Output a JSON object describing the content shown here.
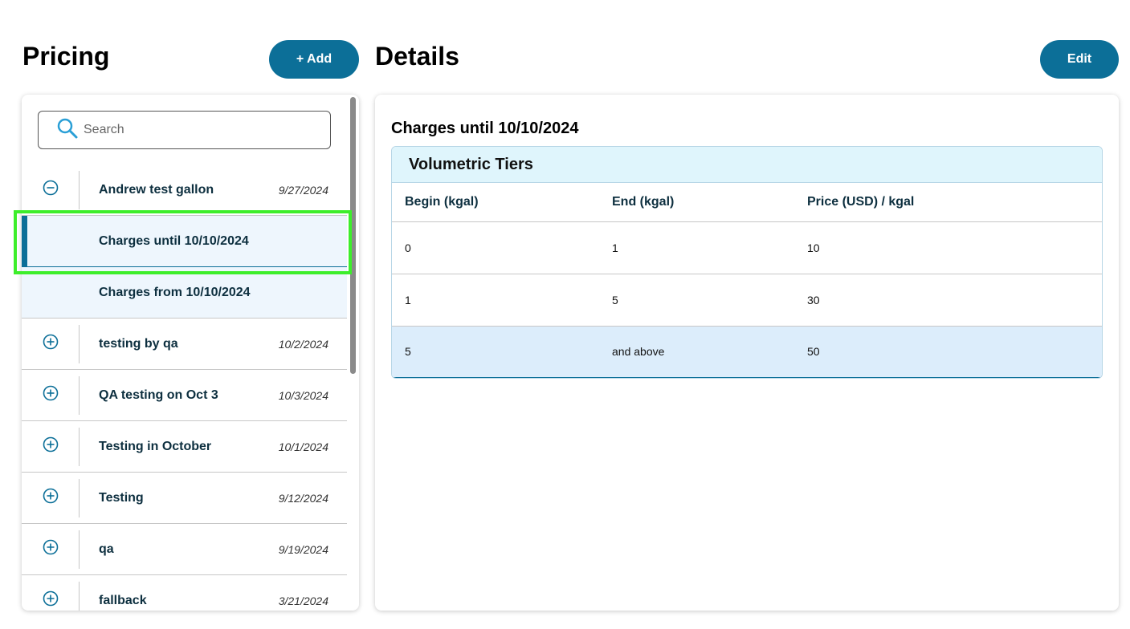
{
  "pricing": {
    "title": "Pricing",
    "add_label": "+ Add",
    "search_placeholder": "Search",
    "items": [
      {
        "name": "Andrew test gallon",
        "date": "9/27/2024",
        "icon": "collapse-circle-icon"
      },
      {
        "name": "Charges until 10/10/2024",
        "date": "",
        "sub": true,
        "selected": true
      },
      {
        "name": "Charges from 10/10/2024",
        "date": "",
        "sub": true
      },
      {
        "name": "testing by qa",
        "date": "10/2/2024",
        "icon": "expand-circle-icon"
      },
      {
        "name": "QA testing on Oct 3",
        "date": "10/3/2024",
        "icon": "expand-circle-icon"
      },
      {
        "name": "Testing in October",
        "date": "10/1/2024",
        "icon": "expand-circle-icon"
      },
      {
        "name": "Testing",
        "date": "9/12/2024",
        "icon": "expand-circle-icon"
      },
      {
        "name": "qa",
        "date": "9/19/2024",
        "icon": "expand-circle-icon"
      },
      {
        "name": "fallback",
        "date": "3/21/2024",
        "icon": "expand-circle-icon"
      }
    ]
  },
  "details": {
    "title": "Details",
    "edit_label": "Edit",
    "section_title": "Charges until 10/10/2024",
    "table_title": "Volumetric Tiers",
    "columns": [
      "Begin (kgal)",
      "End (kgal)",
      "Price (USD) / kgal"
    ],
    "rows": [
      [
        "0",
        "1",
        "10"
      ],
      [
        "1",
        "5",
        "30"
      ],
      [
        "5",
        "and above",
        "50"
      ]
    ]
  },
  "colors": {
    "accent": "#0c6f98",
    "selection_highlight": "#3dee2b",
    "table_header_bg": "#dff5fc",
    "sub_row_bg": "#eef6fd"
  }
}
